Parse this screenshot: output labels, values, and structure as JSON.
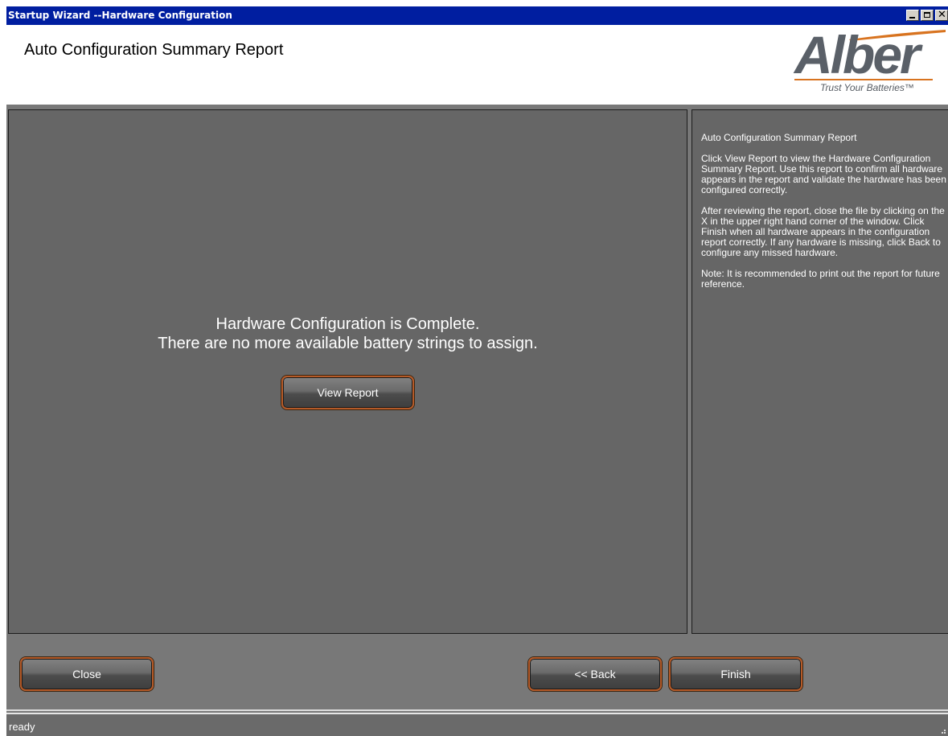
{
  "window": {
    "title": "Startup Wizard --Hardware Configuration"
  },
  "header": {
    "heading": "Auto Configuration Summary Report",
    "logo": {
      "brand": "Alber",
      "tagline": "Trust Your Batteries™"
    }
  },
  "main": {
    "message_line1": "Hardware Configuration is Complete.",
    "message_line2": "There are no more available battery strings to assign.",
    "view_report_label": "View Report"
  },
  "help": {
    "title": "Auto Configuration Summary Report",
    "paragraph1": "Click View Report to view the Hardware Configuration Summary Report. Use this report to confirm all hardware appears in the report and validate the hardware has been configured correctly.",
    "paragraph2": "After reviewing the report, close the file by clicking on the X in the upper right hand corner of the window. Click Finish when all hardware appears in the configuration report correctly. If any hardware is missing, click Back to configure any missed hardware.",
    "paragraph3": "Note: It is recommended to print out the report for future reference."
  },
  "footer": {
    "close_label": "Close",
    "back_label": "<< Back",
    "finish_label": "Finish"
  },
  "status": {
    "text": "ready"
  },
  "colors": {
    "titlebar": "#001ea0",
    "panel": "#666666",
    "button_border": "#b55a28",
    "logo_orange": "#d8731f"
  }
}
